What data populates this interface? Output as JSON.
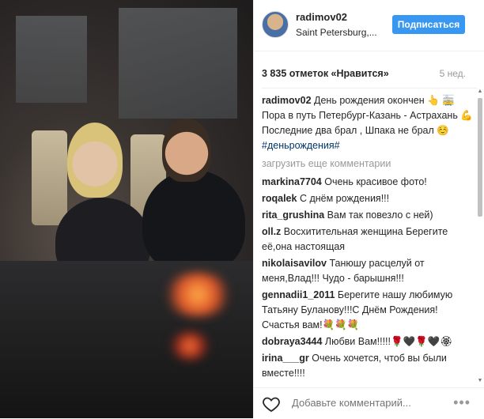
{
  "post": {
    "username": "radimov02",
    "location": "Saint Petersburg,...",
    "follow_label": "Подписаться",
    "likes": "3 835 отметок «Нравится»",
    "age": "5 нед.",
    "caption_user": "radimov02",
    "caption_text": "День рождения окончен 👆 🚋 Пора в путь Петербург-Казань - Астрахань 💪 Последние два брал , Шпака не брал ☺️ ",
    "caption_tag": "#деньрождения#",
    "load_more": "загрузить еще комментарии"
  },
  "comments": [
    {
      "user": "markina7704",
      "text": "Очень красивое фото!"
    },
    {
      "user": "roqalek",
      "text": "С днём рождения!!!"
    },
    {
      "user": "rita_grushina",
      "text": "Вам так повезло с ней)"
    },
    {
      "user": "oll.z",
      "text": "Восхитительная женщина Берегите её,она настоящая"
    },
    {
      "user": "nikolaisavilov",
      "text": "Танюшу расцелуй от меня,Влад!!! Чудо - барышня!!!"
    },
    {
      "user": "gennadii1_2011",
      "text": "Берегите нашу любимую Татьяну Буланову!!!С Днём Рождения!Счастья вам!💐💐💐"
    },
    {
      "user": "dobraya3444",
      "text": "Любви Вам!!!!!🌹🖤🌹🖤🏵"
    },
    {
      "user": "irina___gr",
      "text": "Очень хочется, чтоб вы были вместе!!!!"
    }
  ],
  "footer": {
    "comment_placeholder": "Добавьте комментарий...",
    "more_icon": "•••"
  },
  "colors": {
    "accent": "#3897f0",
    "tag": "#003569",
    "muted": "#999999"
  }
}
